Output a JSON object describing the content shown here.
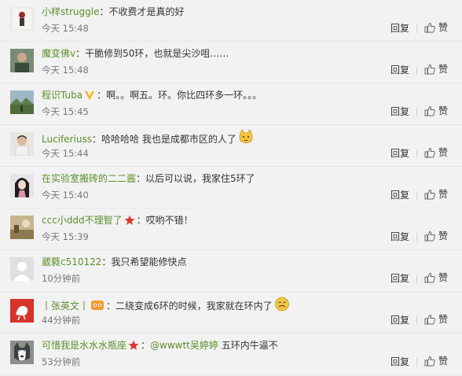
{
  "comments": [
    {
      "user": "小样struggle",
      "text": "不收费才是真的好",
      "time": "今天 15:48",
      "reply_label": "回复",
      "like_label": "赞",
      "avatar_icon": "avatar-figure-icon"
    },
    {
      "user": "魔变佛v",
      "text": "干脆修到50环，也就是尖沙咀……",
      "time": "今天 15:48",
      "reply_label": "回复",
      "like_label": "赞",
      "avatar_icon": "avatar-photo-icon"
    },
    {
      "user": "程识Tuba",
      "text": "啊。。啊五。环。你比四环多一环。。。",
      "time": "今天 15:45",
      "reply_label": "回复",
      "like_label": "赞",
      "badge_icon": "vip-v-badge-icon",
      "avatar_icon": "avatar-landscape-icon"
    },
    {
      "user": "Luciferiuss",
      "text": "哈哈哈哈 我也是成都市区的人了",
      "time": "今天 15:44",
      "reply_label": "回复",
      "like_label": "赞",
      "emoji_icon": "cat-face-emoji-icon",
      "avatar_icon": "avatar-person-icon"
    },
    {
      "user": "在实验室搬砖的二二酱",
      "text": "以后可以说，我家住5环了",
      "time": "今天 15:40",
      "reply_label": "回复",
      "like_label": "赞",
      "avatar_icon": "avatar-girl-icon"
    },
    {
      "user": "ccc小ddd不理智了",
      "text": "哎哟不错！",
      "time": "今天 15:39",
      "reply_label": "回复",
      "like_label": "赞",
      "badge_icon": "red-star-badge-icon",
      "avatar_icon": "avatar-photo-icon"
    },
    {
      "user": "葳蕤c510122",
      "text": "我只希望能修快点",
      "time": "10分钟前",
      "reply_label": "回复",
      "like_label": "赞",
      "avatar_icon": "default-avatar-icon"
    },
    {
      "user": "丨张英文丨",
      "text": "二绕变成6环的时候，我家就在环内了",
      "time": "44分钟前",
      "reply_label": "回复",
      "like_label": "赞",
      "badge_icon": "orange-badge-icon",
      "emoji_icon": "sweat-face-emoji-icon",
      "avatar_icon": "avatar-red-logo-icon"
    },
    {
      "user": "可惜我是水水水瓶座",
      "mention": "@wwwtt吴婷婷",
      "text": "五环内牛逼不",
      "time": "53分钟前",
      "reply_label": "回复",
      "like_label": "赞",
      "badge_icon": "red-star-badge-icon",
      "avatar_icon": "avatar-husky-icon"
    }
  ],
  "colors": {
    "username": "#5b8f2c",
    "background": "#f2f2f2",
    "divider": "#e6e6e6"
  }
}
